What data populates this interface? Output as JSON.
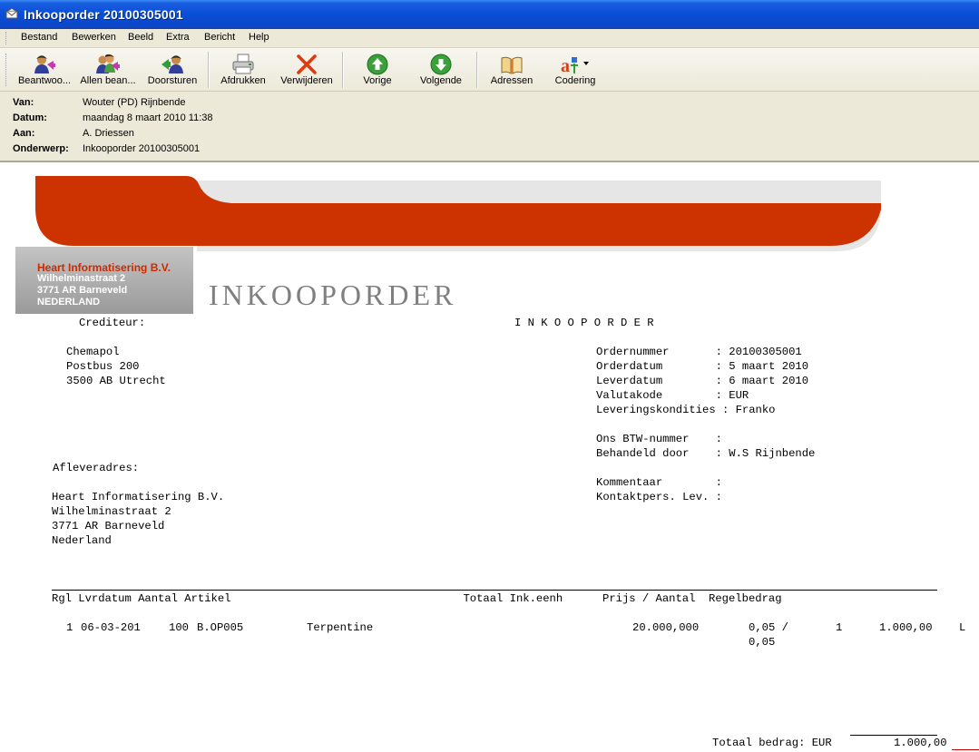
{
  "window": {
    "title": "Inkooporder 20100305001"
  },
  "menu": [
    "Bestand",
    "Bewerken",
    "Beeld",
    "Extra",
    "Bericht",
    "Help"
  ],
  "toolbar": {
    "reply": "Beantwoo...",
    "reply_all": "Allen bean...",
    "forward": "Doorsturen",
    "print": "Afdrukken",
    "delete": "Verwijderen",
    "previous": "Vorige",
    "next": "Volgende",
    "addresses": "Adressen",
    "encoding": "Codering"
  },
  "header": {
    "from_label": "Van:",
    "from": "Wouter (PD) Rijnbende",
    "date_label": "Datum:",
    "date": "maandag 8 maart 2010 11:38",
    "to_label": "Aan:",
    "to": "A. Driessen",
    "subject_label": "Onderwerp:",
    "subject": "Inkooporder 20100305001"
  },
  "letterhead": {
    "company": "Heart Informatisering B.V.",
    "street": "Wilhelminastraat 2",
    "city": "3771 AR  Barneveld",
    "country": "NEDERLAND",
    "doc_title": "INKOOPORDER",
    "brand_red": "#cc3300",
    "brand_grey": "#a6a6a6"
  },
  "order": {
    "creditor_label": "Crediteur:",
    "title_spaced": "I N K O O P O R D E R",
    "creditor_lines": [
      "Chemapol",
      "Postbus 200",
      "3500 AB Utrecht"
    ],
    "info_rows": [
      "Ordernummer       : 20100305001",
      "Orderdatum        : 5 maart 2010",
      "Leverdatum        : 6 maart 2010",
      "Valutakode        : EUR",
      "Leveringskondities : Franko",
      "",
      "Ons BTW-nummer    :",
      "Behandeld door    : W.S Rijnbende",
      "",
      "Kommentaar        :",
      "Kontaktpers. Lev. :"
    ],
    "delivery_label": "Afleveradres:",
    "delivery_lines": [
      "Heart Informatisering B.V.",
      "Wilhelminastraat 2",
      "3771 AR Barneveld",
      "Nederland"
    ],
    "table_header": "Rgl Lvrdatum Aantal Artikel                                   Totaal Ink.eenh      Prijs / Aantal  Regelbedrag",
    "line": {
      "rgl": "1",
      "date": "06-03-201",
      "qty": "100",
      "article": "B.OP005",
      "description": "Terpentine",
      "total_unit": "20.000,000",
      "price": "0,05 /",
      "price2": "0,05",
      "per": "1",
      "amount": "1.000,00",
      "flag": "L"
    },
    "total_label": "Totaal bedrag: EUR",
    "total_value": "1.000,00"
  }
}
